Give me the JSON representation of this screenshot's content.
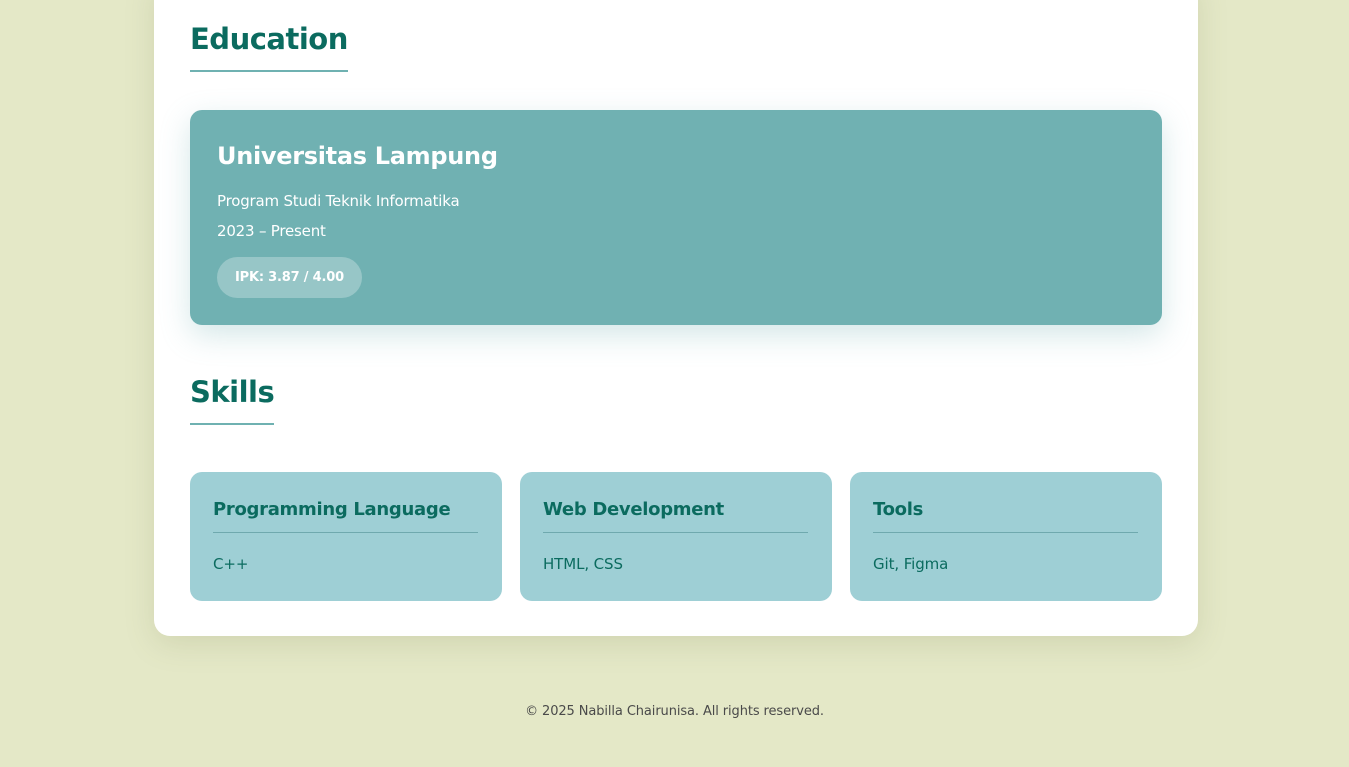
{
  "education": {
    "section_title": "Education",
    "institution": "Universitas Lampung",
    "program": "Program Studi Teknik Informatika",
    "years": "2023 – Present",
    "gpa_badge": "IPK: 3.87 / 4.00"
  },
  "skills": {
    "section_title": "Skills",
    "cards": [
      {
        "title": "Programming Language",
        "items": "C++"
      },
      {
        "title": "Web Development",
        "items": "HTML, CSS"
      },
      {
        "title": "Tools",
        "items": "Git, Figma"
      }
    ]
  },
  "footer": {
    "text": "© 2025 Nabilla Chairunisa. All rights reserved."
  },
  "colors": {
    "page_background": "#e4e8c7",
    "heading": "#0b6b5f",
    "education_card": "#70b1b2",
    "skill_card": "#9ecfd5"
  }
}
